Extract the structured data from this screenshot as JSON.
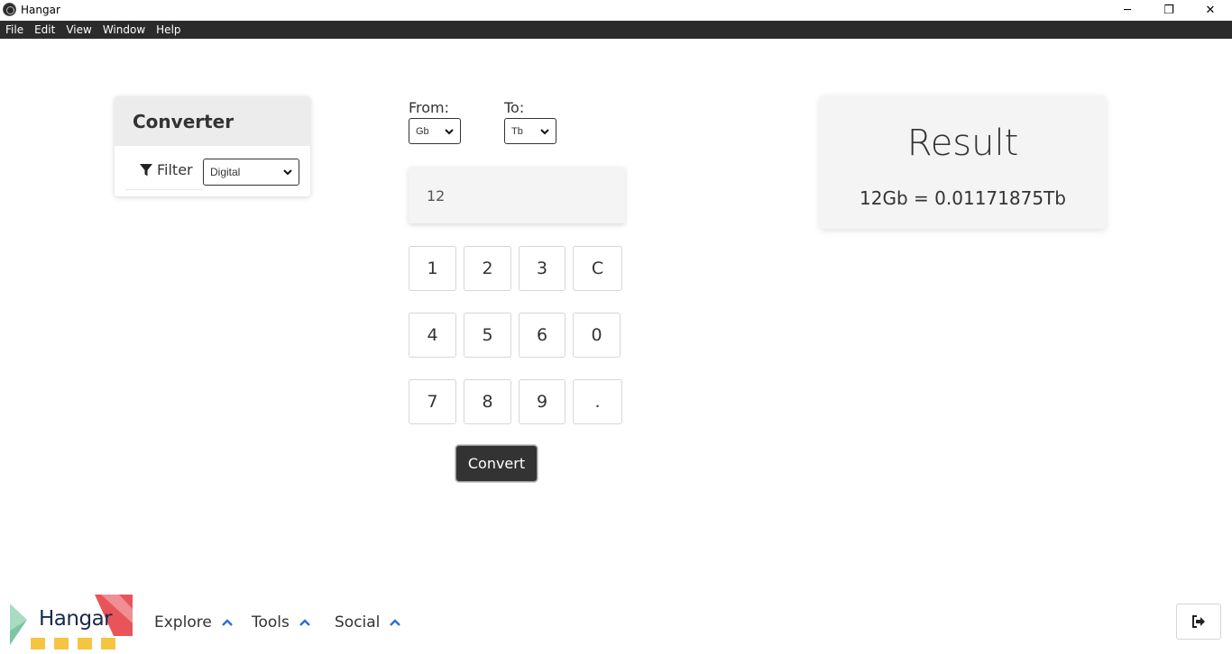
{
  "window": {
    "title": "Hangar",
    "controls": {
      "minimize": "─",
      "maximize": "❐",
      "close": "✕"
    }
  },
  "menubar": [
    "File",
    "Edit",
    "View",
    "Window",
    "Help"
  ],
  "converter": {
    "title": "Converter",
    "filter_label": "Filter",
    "filter_value": "Digital"
  },
  "units": {
    "from_label": "From:",
    "from_value": "Gb",
    "to_label": "To:",
    "to_value": "Tb"
  },
  "input": {
    "value": "12"
  },
  "keypad": [
    "1",
    "2",
    "3",
    "C",
    "4",
    "5",
    "6",
    "0",
    "7",
    "8",
    "9",
    "."
  ],
  "convert_label": "Convert",
  "result": {
    "title": "Result",
    "value": "12Gb = 0.01171875Tb"
  },
  "footer": {
    "logo_text": "Hangar",
    "nav": [
      "Explore",
      "Tools",
      "Social"
    ]
  },
  "colors": {
    "menubar": "#2b2b2b",
    "accent_blue": "#2a6fd6",
    "logo_red": "#e8545a",
    "logo_green": "#7cc6a0",
    "logo_yellow": "#f5c542"
  },
  "icons": {
    "filter": "filter-icon",
    "caret": "chevron-up-icon",
    "logout": "sign-out-icon"
  }
}
